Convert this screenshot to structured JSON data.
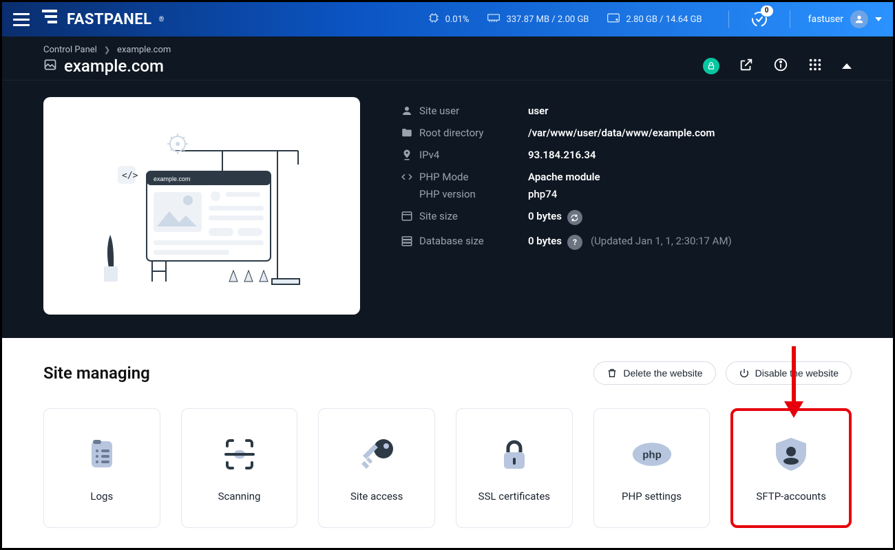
{
  "brand": {
    "name": "FASTPANEL",
    "reg": "®"
  },
  "topbar": {
    "cpu_pct": "0.01%",
    "mem": "337.87 MB / 2.00 GB",
    "disk": "2.80 GB / 14.64 GB",
    "tasks_badge": "0",
    "username": "fastuser"
  },
  "breadcrumb": {
    "root": "Control Panel",
    "site": "example.com"
  },
  "page_title": "example.com",
  "info": {
    "site_user_label": "Site user",
    "site_user_value": "user",
    "root_dir_label": "Root directory",
    "root_dir_value": "/var/www/user/data/www/example.com",
    "ipv4_label": "IPv4",
    "ipv4_value": "93.184.216.34",
    "php_mode_label": "PHP Mode",
    "php_mode_value": "Apache module",
    "php_ver_label": "PHP version",
    "php_ver_value": "php74",
    "site_size_label": "Site size",
    "site_size_value": "0 bytes",
    "db_size_label": "Database size",
    "db_size_value": "0 bytes",
    "db_updated": "(Updated Jan 1, 1, 2:30:17 AM)"
  },
  "preview_url_text": "example.com",
  "managing": {
    "heading": "Site managing",
    "delete_label": "Delete the website",
    "disable_label": "Disable the website",
    "tiles": {
      "logs": "Logs",
      "scanning": "Scanning",
      "site_access": "Site access",
      "ssl": "SSL certificates",
      "php": "PHP settings",
      "sftp": "SFTP-accounts"
    }
  }
}
